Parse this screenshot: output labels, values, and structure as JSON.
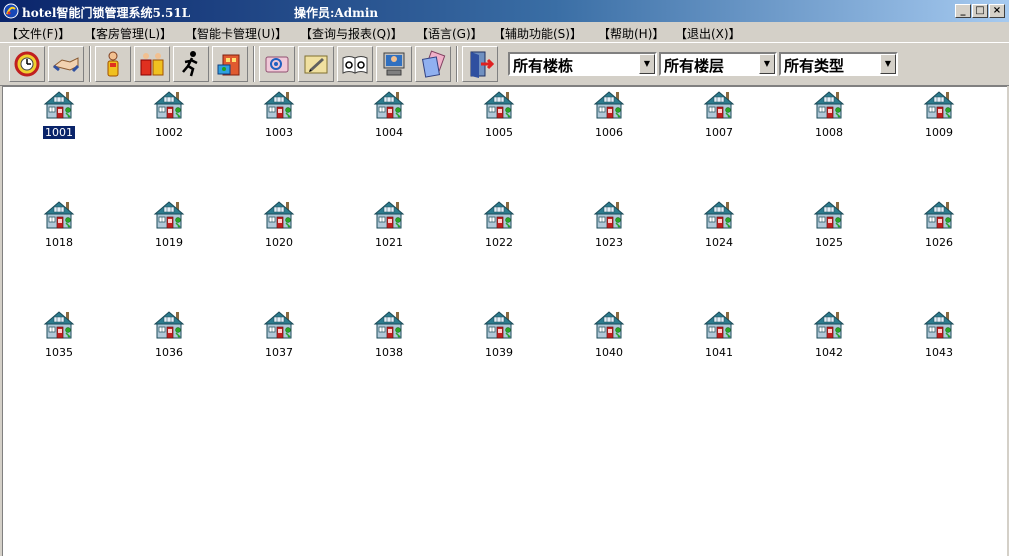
{
  "window": {
    "title": "hotel智能门锁管理系统5.51L",
    "operator": "操作员:Admin",
    "controls": {
      "minimize": "_",
      "maximize": "□",
      "close": "×"
    }
  },
  "menu": [
    "【文件(F)】",
    "【客房管理(L)】",
    "【智能卡管理(U)】",
    "【查询与报表(Q)】",
    "【语言(G)】",
    "【辅助功能(S)】",
    "【帮助(H)】",
    "【退出(X)】"
  ],
  "toolbar": {
    "icons": [
      "alarm-clock-gear-icon",
      "handshake-icon",
      "person-card-icon",
      "group-card-icon",
      "running-man-icon",
      "building-card-icon",
      "card-reader-icon",
      "card-edit-icon",
      "open-book-icon",
      "computer-user-icon",
      "cards-stack-icon",
      "exit-door-icon"
    ],
    "building_select": "所有楼栋",
    "floor_select": "所有楼层",
    "type_select": "所有类型",
    "dropdown_arrow": "▼"
  },
  "rooms": {
    "selected": "1001",
    "rows": [
      [
        "1001",
        "1002",
        "1003",
        "1004",
        "1005",
        "1006",
        "1007",
        "1008",
        "1009"
      ],
      [
        "1018",
        "1019",
        "1020",
        "1021",
        "1022",
        "1023",
        "1024",
        "1025",
        "1026"
      ],
      [
        "1035",
        "1036",
        "1037",
        "1038",
        "1039",
        "1040",
        "1041",
        "1042",
        "1043"
      ]
    ]
  },
  "colors": {
    "title_gradient_start": "#0a246a",
    "title_gradient_end": "#a6caf0",
    "selection": "#0a246a",
    "house_roof": "#2d7d8f",
    "house_wall": "#b0c8d8",
    "house_door": "#c02020",
    "key_green": "#2aa52a"
  }
}
